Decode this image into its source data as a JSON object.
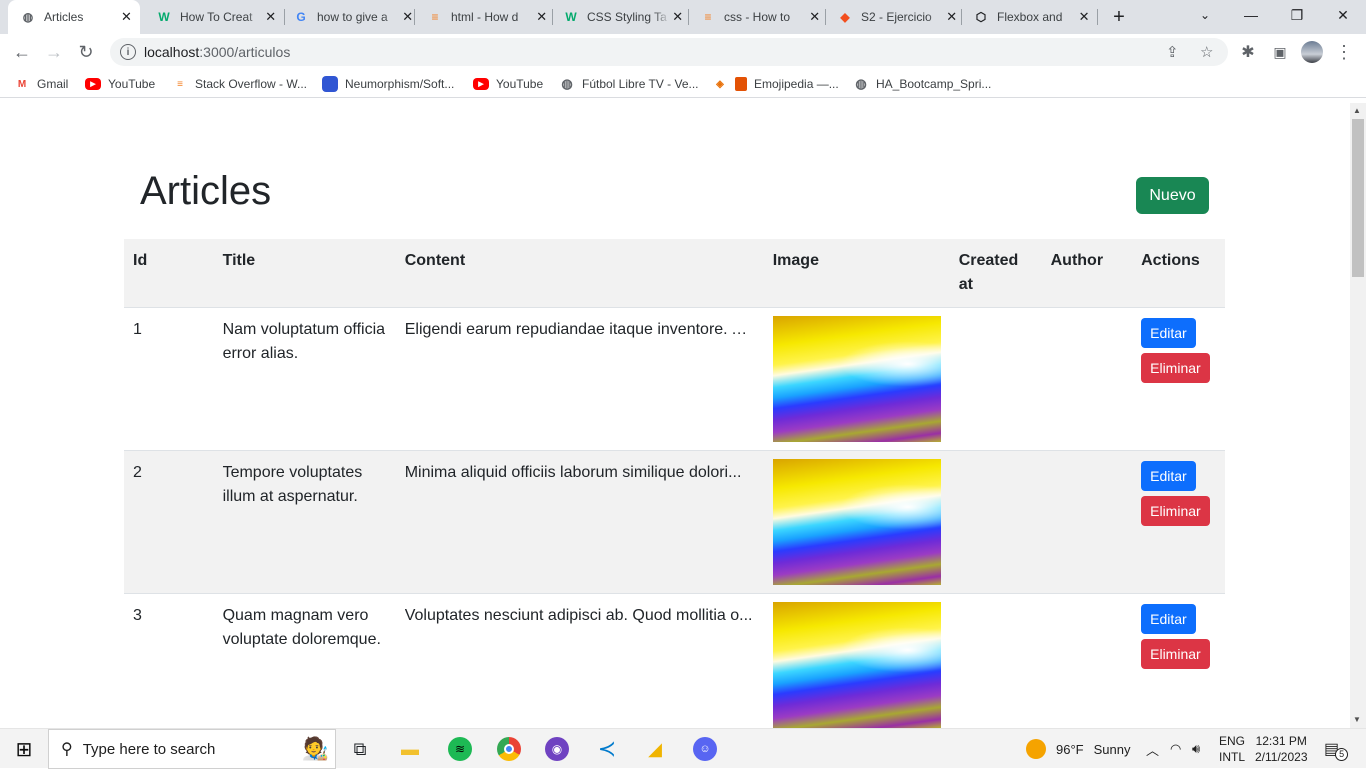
{
  "browser": {
    "tabs": [
      {
        "title": "Articles",
        "favicon": "globe-icon",
        "active": true
      },
      {
        "title": "How To Creat",
        "favicon": "w3schools-icon"
      },
      {
        "title": "how to give a",
        "favicon": "google-icon"
      },
      {
        "title": "html - How d",
        "favicon": "stackoverflow-icon"
      },
      {
        "title": "CSS Styling Ta",
        "favicon": "w3schools-icon"
      },
      {
        "title": "css - How to",
        "favicon": "stackoverflow-icon"
      },
      {
        "title": "S2 - Ejercicio",
        "favicon": "figma-icon"
      },
      {
        "title": "Flexbox and",
        "favicon": "codepen-icon"
      }
    ],
    "url_host": "localhost",
    "url_path": ":3000/articulos",
    "bookmarks": [
      {
        "label": "Gmail",
        "icon": "gmail-icon"
      },
      {
        "label": "YouTube",
        "icon": "youtube-icon"
      },
      {
        "label": "Stack Overflow - W...",
        "icon": "stackoverflow-icon"
      },
      {
        "label": "Neumorphism/Soft...",
        "icon": "neumorphism-icon"
      },
      {
        "label": "YouTube",
        "icon": "youtube-icon"
      },
      {
        "label": "Fútbol Libre TV - Ve...",
        "icon": "globe-icon"
      },
      {
        "label": "",
        "icon": "bookmark-icon"
      },
      {
        "label": "Emojipedia —...",
        "icon": "emojipedia-icon"
      },
      {
        "label": "HA_Bootcamp_Spri...",
        "icon": "globe-icon"
      }
    ]
  },
  "page": {
    "heading": "Articles",
    "new_button": "Nuevo",
    "table": {
      "headers": [
        "Id",
        "Title",
        "Content",
        "Image",
        "Created at",
        "Author",
        "Actions"
      ],
      "rows": [
        {
          "id": "1",
          "title": "Nam voluptatum officia error alias.",
          "content": "Eligendi earum repudiandae itaque inventore. A...",
          "created_at": "",
          "author": "",
          "edit": "Editar",
          "delete": "Eliminar"
        },
        {
          "id": "2",
          "title": "Tempore voluptates illum at aspernatur.",
          "content": "Minima aliquid officiis laborum similique dolori...",
          "created_at": "",
          "author": "",
          "edit": "Editar",
          "delete": "Eliminar"
        },
        {
          "id": "3",
          "title": "Quam magnam vero voluptate doloremque.",
          "content": "Voluptates nesciunt adipisci ab. Quod mollitia o...",
          "created_at": "",
          "author": "",
          "edit": "Editar",
          "delete": "Eliminar"
        }
      ]
    },
    "colors": {
      "new": "#198754",
      "edit": "#0d6efd",
      "delete": "#dc3545",
      "stripe": "#f2f2f2"
    }
  },
  "taskbar": {
    "search_placeholder": "Type here to search",
    "weather_temp": "96°F",
    "weather_text": "Sunny",
    "lang_top": "ENG",
    "lang_bottom": "INTL",
    "time": "12:31 PM",
    "date": "2/11/2023",
    "notification_count": "5"
  }
}
